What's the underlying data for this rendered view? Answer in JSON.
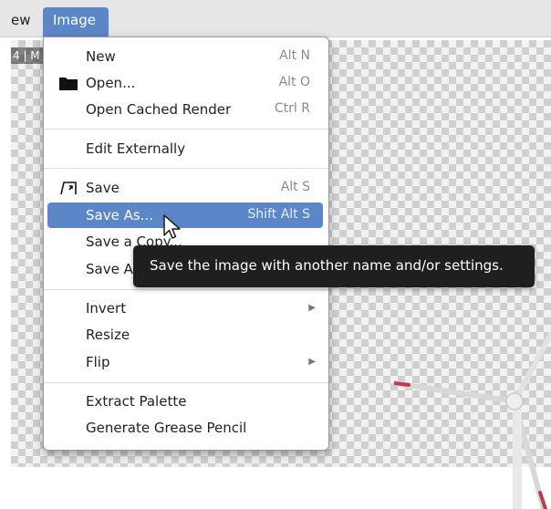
{
  "menubar": {
    "prev_label": "ew",
    "active_label": "Image"
  },
  "canvas": {
    "label": "4 | M"
  },
  "menu": {
    "items": [
      {
        "label": "New",
        "shortcut": "Alt N"
      },
      {
        "label": "Open...",
        "shortcut": "Alt O",
        "icon": "folder-icon"
      },
      {
        "label": "Open Cached Render",
        "shortcut": "Ctrl R"
      },
      {
        "label": "Edit Externally"
      },
      {
        "label": "Save",
        "shortcut": "Alt S",
        "icon": "save-icon"
      },
      {
        "label": "Save As...",
        "shortcut": "Shift Alt S",
        "highlighted": true
      },
      {
        "label": "Save a Copy..."
      },
      {
        "label": "Save All"
      },
      {
        "label": "Invert",
        "submenu": true
      },
      {
        "label": "Resize"
      },
      {
        "label": "Flip",
        "submenu": true
      },
      {
        "label": "Extract Palette"
      },
      {
        "label": "Generate Grease Pencil"
      }
    ]
  },
  "tooltip": {
    "text": "Save the image with another name and/or settings."
  },
  "colors": {
    "accent": "#5b87c9",
    "tooltip_bg": "#1f1f1f"
  }
}
